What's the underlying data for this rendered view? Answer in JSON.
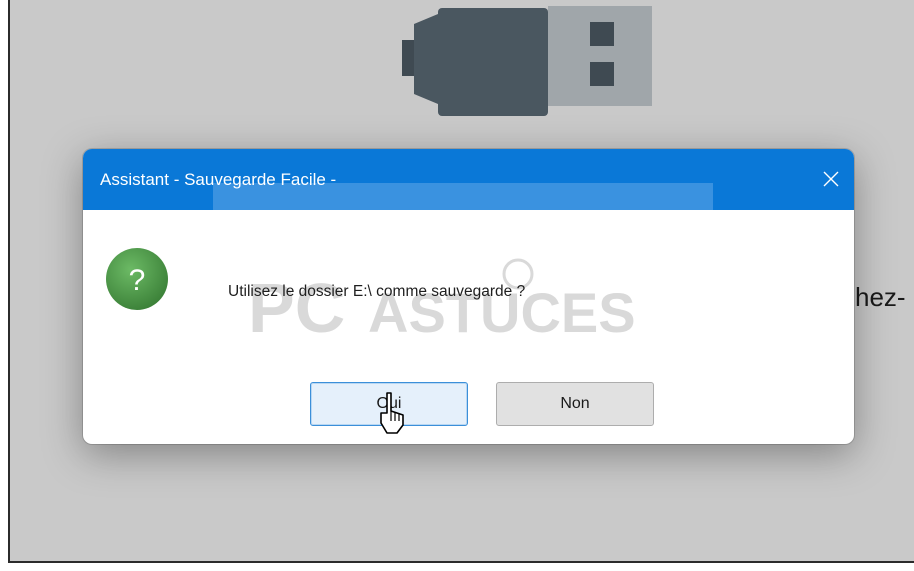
{
  "dialog": {
    "title": "Assistant - Sauvegarde Facile -",
    "message": "Utilisez le dossier E:\\ comme sauvegarde ?",
    "buttons": {
      "yes": "Oui",
      "no": "Non"
    },
    "icon": "question-icon",
    "close_icon": "close-icon"
  },
  "background": {
    "text_fragment": "hez-"
  },
  "watermark": {
    "text": "PC ASTUCES"
  },
  "colors": {
    "titlebar": "#0a78d7",
    "question_icon": "#4c9a48",
    "background_window": "#c9c9c9",
    "default_button_border": "#3b8fd9"
  }
}
